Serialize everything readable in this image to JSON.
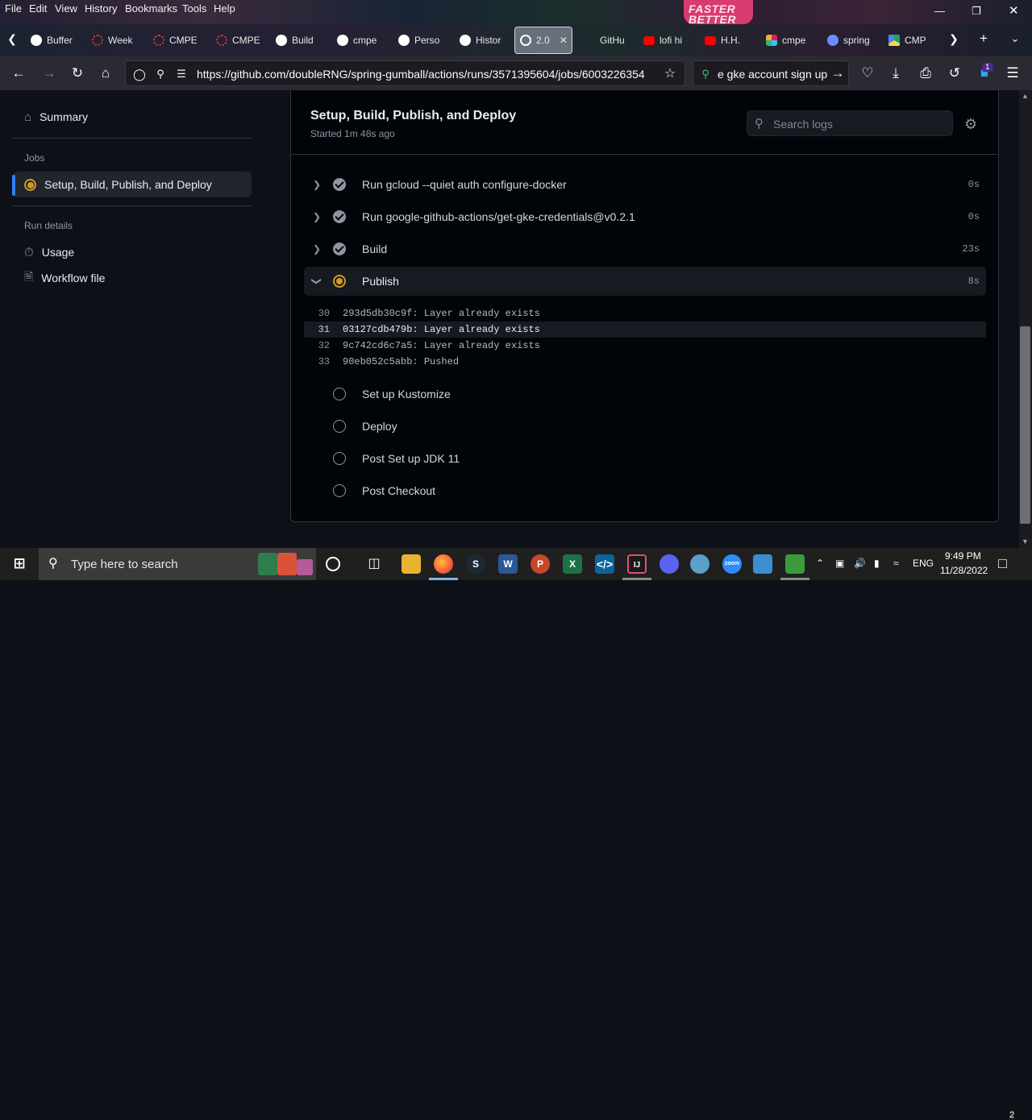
{
  "menubar": {
    "items": [
      "File",
      "Edit",
      "View",
      "History",
      "Bookmarks",
      "Tools",
      "Help"
    ],
    "promo": "FASTER BETTER"
  },
  "tabs": [
    {
      "label": "Buffer",
      "color": "#ffffff"
    },
    {
      "label": "Week",
      "color": "#e0323c"
    },
    {
      "label": "CMPE",
      "color": "#e0323c"
    },
    {
      "label": "CMPE",
      "color": "#e0323c"
    },
    {
      "label": "Build",
      "color": "#ffffff"
    },
    {
      "label": "cmpe",
      "color": "#ffffff"
    },
    {
      "label": "Perso",
      "color": "#ffffff"
    },
    {
      "label": "Histor",
      "color": "#ffffff"
    },
    {
      "label": "2.0",
      "color": "#ffffff"
    },
    {
      "label": "GitHu",
      "color": "#ffffff"
    },
    {
      "label": "lofi hi",
      "color": "#ff0000"
    },
    {
      "label": "H.H.",
      "color": "#ff0000"
    },
    {
      "label": "cmpe",
      "color": "#e01e5a"
    },
    {
      "label": "spring",
      "color": "#6a8cff"
    },
    {
      "label": "CMP",
      "color": "#1fa463"
    }
  ],
  "nav": {
    "url": "https://github.com/doubleRNG/spring-gumball/actions/runs/3571395604/jobs/6003226354",
    "search_value": "e gke account sign up",
    "badge": "1"
  },
  "sidebar": {
    "summary": "Summary",
    "jobs_heading": "Jobs",
    "job": "Setup, Build, Publish, and Deploy",
    "run_details_heading": "Run details",
    "usage": "Usage",
    "workflow_file": "Workflow file"
  },
  "panel": {
    "title": "Setup, Build, Publish, and Deploy",
    "started": "Started 1m 48s ago",
    "search_placeholder": "Search logs"
  },
  "steps_done": [
    {
      "name": "Run gcloud --quiet auth configure-docker",
      "duration": "0s"
    },
    {
      "name": "Run google-github-actions/get-gke-credentials@v0.2.1",
      "duration": "0s"
    },
    {
      "name": "Build",
      "duration": "23s"
    }
  ],
  "step_running": {
    "name": "Publish",
    "duration": "8s"
  },
  "log_lines": [
    {
      "n": "30",
      "text": "293d5db30c9f: Layer already exists"
    },
    {
      "n": "31",
      "text": "03127cdb479b: Layer already exists"
    },
    {
      "n": "32",
      "text": "9c742cd6c7a5: Layer already exists"
    },
    {
      "n": "33",
      "text": "90eb052c5abb: Pushed"
    }
  ],
  "steps_pending": [
    {
      "name": "Set up Kustomize"
    },
    {
      "name": "Deploy"
    },
    {
      "name": "Post Set up JDK 11"
    },
    {
      "name": "Post Checkout"
    }
  ],
  "taskbar": {
    "search_placeholder": "Type here to search",
    "language": "ENG",
    "time": "9:49 PM",
    "date": "11/28/2022",
    "notification_count": "2"
  }
}
